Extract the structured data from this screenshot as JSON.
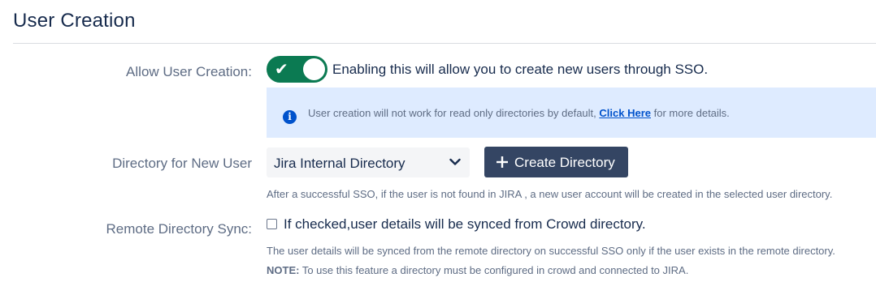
{
  "section": {
    "title": "User Creation"
  },
  "allow_user_creation": {
    "label": "Allow User Creation:",
    "enabled": true,
    "description": "Enabling this will allow you to create new users through SSO."
  },
  "info": {
    "icon": "info-icon",
    "text_before": "User creation will not work for read only directories by default, ",
    "link": "Click Here",
    "text_after": " for more details."
  },
  "directory": {
    "label": "Directory for New User",
    "selected": "Jira Internal Directory",
    "create_button": "Create Directory",
    "help": "After a successful SSO, if the user is not found in JIRA , a new user account will be created in the selected user directory."
  },
  "remote_sync": {
    "label": "Remote Directory Sync:",
    "checked": false,
    "checkbox_label": "If checked,user details will be synced from Crowd directory.",
    "help": "The user details will be synced from the remote directory on successful SSO only if the user exists in the remote directory.",
    "note_label": "NOTE:",
    "note_text": " To use this feature a directory must be configured in crowd and connected to JIRA."
  },
  "colors": {
    "toggle_on": "#0b7a52",
    "info_bg": "#deebff",
    "link": "#0052cc",
    "button_bg": "#344563"
  }
}
